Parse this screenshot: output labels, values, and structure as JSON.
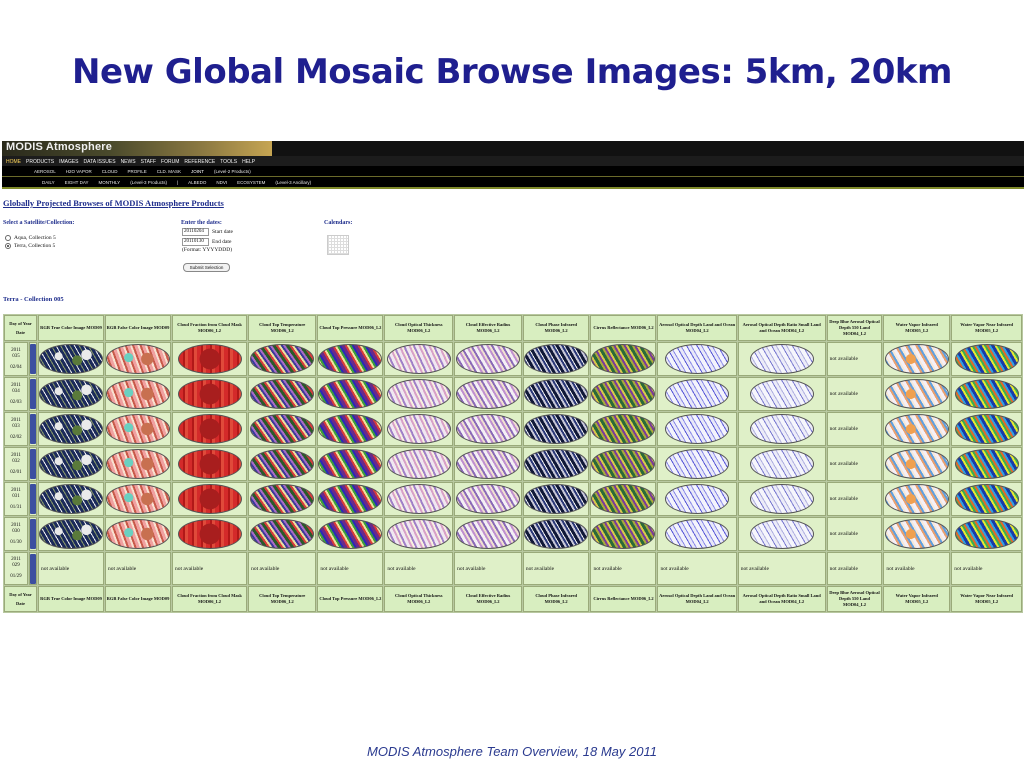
{
  "slide": {
    "title": "New Global Mosaic Browse Images: 5km, 20km",
    "footer": "MODIS Atmosphere Team Overview, 18 May 2011"
  },
  "site": {
    "logo": "MODIS Atmosphere",
    "main_nav": [
      "HOME",
      "PRODUCTS",
      "IMAGES",
      "DATA ISSUES",
      "NEWS",
      "STAFF",
      "FORUM",
      "REFERENCE",
      "TOOLS",
      "HELP"
    ],
    "sub_nav_1": [
      "AEROSOL",
      "H2O VAPOR",
      "CLOUD",
      "PROFILE",
      "CLD. MASK",
      "JOINT",
      "(Level-2 Products)"
    ],
    "sub_nav_2": [
      "DAILY",
      "EIGHT DAY",
      "MONTHLY",
      "(Level-3 Products)",
      "|",
      "ALBEDO",
      "NDVI",
      "ECOSYSTEM",
      "(Level-3 Ancillary)"
    ]
  },
  "page": {
    "title": "Globally Projected Browses of MODIS Atmosphere Products",
    "select_label": "Select a Satellite/Collection:",
    "radio_aqua": "Aqua, Collection 5",
    "radio_terra": "Terra, Collection 5",
    "dates_label": "Enter the dates:",
    "start_value": "20110204",
    "start_label": "Start date",
    "end_value": "20110130",
    "end_label": "End date",
    "format": "(Format: YYYYDDD)",
    "submit": "Submit Selection",
    "calendars_label": "Calendars:",
    "collection_label": "Terra - Collection 005"
  },
  "table": {
    "day_header_1": "Day of Year",
    "day_header_2": "Date",
    "columns": [
      "RGB True Color Image MOD09",
      "RGB False Color Image MOD09",
      "Cloud Fraction from Cloud Mask MOD06_L2",
      "Cloud Top Temperature MOD06_L2",
      "Cloud Top Pressure MOD06_L2",
      "Cloud Optical Thickness MOD06_L2",
      "Cloud Effective Radius MOD06_L2",
      "Cloud Phase Infrared MOD06_L2",
      "Cirrus Reflectance MOD06_L2",
      "Aerosol Optical Depth Land and Ocean MOD04_L2",
      "Aerosol Optical Depth Ratio Small Land and Ocean MOD04_L2",
      "Deep Blue Aerosol Optical Depth 550 Land MOD04_L2",
      "Water Vapor Infrared MOD05_L2",
      "Water Vapor Near Infrared MOD05_L2"
    ],
    "not_available": "not available",
    "rows": [
      {
        "year": "2011",
        "doy": "035",
        "date": "02/04"
      },
      {
        "year": "2011",
        "doy": "034",
        "date": "02/03"
      },
      {
        "year": "2011",
        "doy": "033",
        "date": "02/02"
      },
      {
        "year": "2011",
        "doy": "032",
        "date": "02/01"
      },
      {
        "year": "2011",
        "doy": "031",
        "date": "01/31"
      },
      {
        "year": "2011",
        "doy": "030",
        "date": "01/30"
      },
      {
        "year": "2011",
        "doy": "029",
        "date": "01/29"
      }
    ],
    "map_classes": [
      "m-rgb",
      "m-false",
      "m-cf",
      "m-ctt",
      "m-ctp",
      "m-cot",
      "m-cer",
      "m-cpi",
      "m-cir",
      "m-aod",
      "m-aor",
      "na",
      "m-wvi",
      "m-wvn"
    ]
  }
}
